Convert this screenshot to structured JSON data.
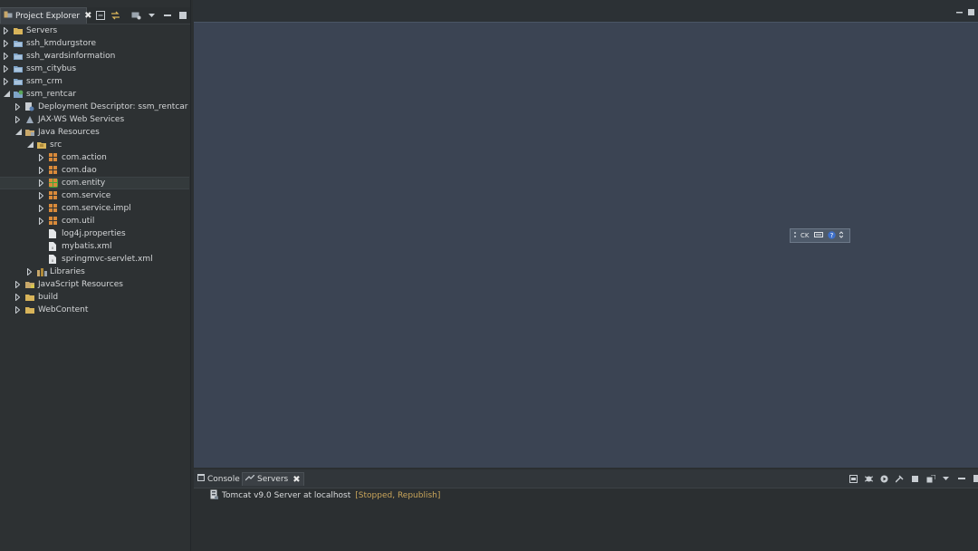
{
  "project_explorer": {
    "tab_label": "Project Explorer",
    "tree": [
      {
        "label": "Servers",
        "icon": "folder-icon",
        "level": 0,
        "expanded": false
      },
      {
        "label": "ssh_kmdurgstore",
        "icon": "project-icon",
        "level": 0,
        "expanded": false
      },
      {
        "label": "ssh_wardsinformation",
        "icon": "project-icon",
        "level": 0,
        "expanded": false
      },
      {
        "label": "ssm_citybus",
        "icon": "project-icon",
        "level": 0,
        "expanded": false
      },
      {
        "label": "ssm_crm",
        "icon": "project-icon",
        "level": 0,
        "expanded": false
      },
      {
        "label": "ssm_rentcar",
        "icon": "web-project-icon",
        "level": 0,
        "expanded": true
      },
      {
        "label": "Deployment Descriptor: ssm_rentcar",
        "icon": "deployment-descriptor-icon",
        "level": 1,
        "expanded": false
      },
      {
        "label": "JAX-WS Web Services",
        "icon": "web-services-icon",
        "level": 1,
        "expanded": false
      },
      {
        "label": "Java Resources",
        "icon": "java-resources-icon",
        "level": 1,
        "expanded": true
      },
      {
        "label": "src",
        "icon": "source-folder-icon",
        "level": 2,
        "expanded": true
      },
      {
        "label": "com.action",
        "icon": "package-icon",
        "level": 3,
        "expanded": false
      },
      {
        "label": "com.dao",
        "icon": "package-icon",
        "level": 3,
        "expanded": false
      },
      {
        "label": "com.entity",
        "icon": "package-icon",
        "level": 3,
        "expanded": false,
        "selected": true
      },
      {
        "label": "com.service",
        "icon": "package-icon",
        "level": 3,
        "expanded": false
      },
      {
        "label": "com.service.impl",
        "icon": "package-icon",
        "level": 3,
        "expanded": false
      },
      {
        "label": "com.util",
        "icon": "package-icon",
        "level": 3,
        "expanded": false
      },
      {
        "label": "log4j.properties",
        "icon": "file-icon",
        "level": 3,
        "leaf": true
      },
      {
        "label": "mybatis.xml",
        "icon": "xml-file-icon",
        "level": 3,
        "leaf": true
      },
      {
        "label": "springmvc-servlet.xml",
        "icon": "xml-file-icon",
        "level": 3,
        "leaf": true
      },
      {
        "label": "Libraries",
        "icon": "libraries-icon",
        "level": 2,
        "expanded": false
      },
      {
        "label": "JavaScript Resources",
        "icon": "javascript-resources-icon",
        "level": 1,
        "expanded": false
      },
      {
        "label": "build",
        "icon": "folder-icon",
        "level": 1,
        "expanded": false
      },
      {
        "label": "WebContent",
        "icon": "folder-icon",
        "level": 1,
        "expanded": false
      }
    ]
  },
  "input_method_bar": {
    "lang": "CK"
  },
  "bottom_panel": {
    "tabs": [
      {
        "label": "Console",
        "icon": "console-icon",
        "active": false
      },
      {
        "label": "Servers",
        "icon": "servers-icon",
        "active": true
      }
    ],
    "server_entry": {
      "name": "Tomcat v9.0 Server at localhost",
      "state": "[Stopped, Republish]"
    }
  },
  "colors": {
    "editor_bg": "#3b4453",
    "panel_bg": "#2b2f31",
    "server_state": "#c8a45a",
    "selection_highlight": "#3fa83a"
  }
}
